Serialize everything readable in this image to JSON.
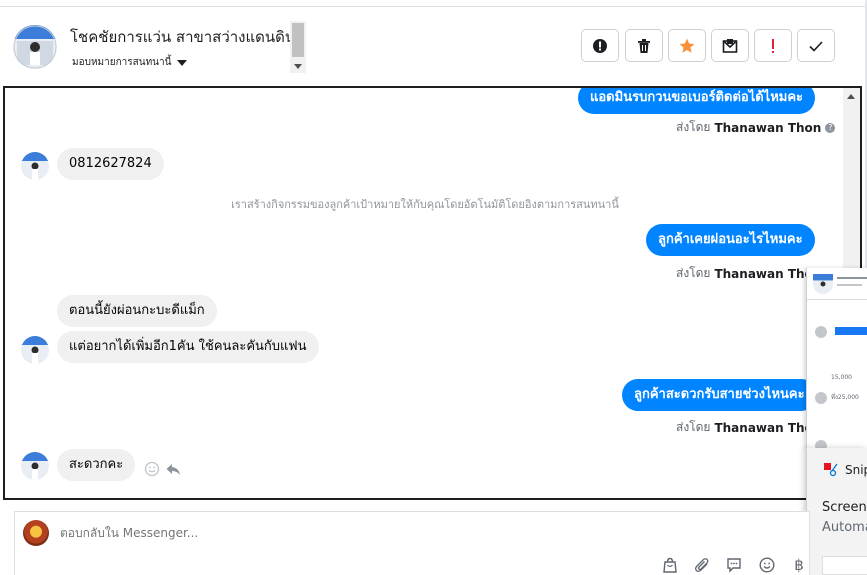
{
  "header": {
    "title": "โชคชัยการแว่น สาขาสว่างแดนดิน",
    "subtitle": "มอบหมายการสนทนานี้",
    "toolbar": [
      {
        "name": "spam-button",
        "icon": "alert-circle-icon"
      },
      {
        "name": "delete-button",
        "icon": "trash-icon"
      },
      {
        "name": "star-button",
        "icon": "star-icon"
      },
      {
        "name": "mark-unread-button",
        "icon": "envelope-icon"
      },
      {
        "name": "important-button",
        "icon": "exclamation-icon"
      },
      {
        "name": "done-button",
        "icon": "check-icon"
      }
    ]
  },
  "conversation": {
    "messages": [
      {
        "type": "outgoing",
        "text": "แอดมินรบกวนขอเบอร์ติดต่อได้ไหมคะ",
        "sent_by_label": "ส่งโดย",
        "sender": "Thanawan Thon"
      },
      {
        "type": "incoming",
        "text": "0812627824"
      },
      {
        "type": "system",
        "text": "เราสร้างกิจกรรมของลูกค้าเป้าหมายให้กับคุณโดยอัตโนมัติโดยอิงตามการสนทนานี้"
      },
      {
        "type": "outgoing",
        "text": "ลูกค้าเคยผ่อนอะไรไหมคะ",
        "sent_by_label": "ส่งโดย",
        "sender": "Thanawan Thon"
      },
      {
        "type": "incoming",
        "text": "ตอนนี้ยังผ่อนกะบะดีแม็ก"
      },
      {
        "type": "incoming",
        "text": "แต่อยากได้เพิ่มอีก1คัน ใช้คนละคันกับแฟน"
      },
      {
        "type": "outgoing",
        "text": "ลูกค้าสะดวกรับสายช่วงไหนคะ",
        "sent_by_label": "ส่งโดย",
        "sender": "Thanawan Thon"
      },
      {
        "type": "incoming",
        "text": "สะดวกคะ"
      }
    ]
  },
  "overlay": {
    "snip_title": "Snip",
    "snip_line1": "Screens",
    "snip_line2": "Automa",
    "thumb_values": [
      "15,000",
      "ที่ง25,000"
    ]
  },
  "composer": {
    "placeholder": "ตอบกลับใน Messenger...",
    "icons": [
      "shopping-bag-icon",
      "paperclip-icon",
      "chat-bubble-icon",
      "emoji-icon",
      "baht-icon"
    ]
  },
  "colors": {
    "outgoing_bubble": "#0084ff",
    "incoming_bubble": "#f0f0f0",
    "star": "#f7923b",
    "important": "#e41e3f"
  }
}
